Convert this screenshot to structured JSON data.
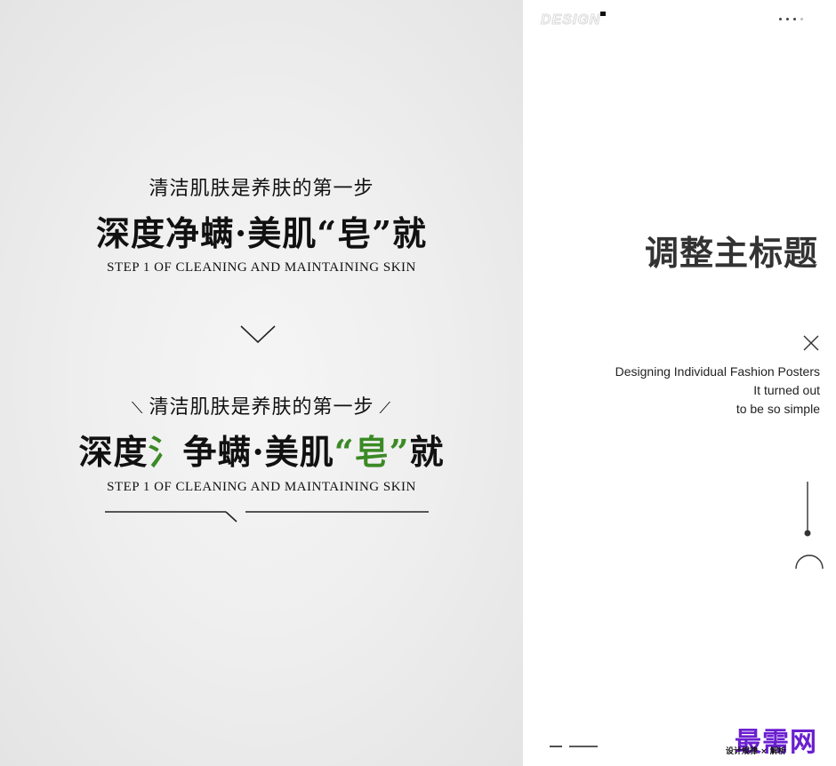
{
  "poster": {
    "block1": {
      "subtitle": "清洁肌肤是养肤的第一步",
      "title": "深度净螨·美肌“皂”就",
      "caption": "STEP 1 OF CLEANING AND MAINTAINING SKIN"
    },
    "block2": {
      "subtitle": "清洁肌肤是养肤的第一步",
      "title_parts": [
        "深度",
        "氵",
        "争螨·美肌",
        "“皂”",
        "就"
      ],
      "caption": "STEP 1 OF CLEANING AND MAINTAINING SKIN"
    },
    "accent_color": "#3b8a25"
  },
  "right": {
    "brand": "DESIGN",
    "main_title": "调整主标题",
    "description": [
      "Designing Individual Fashion Posters",
      "It turned out",
      "to be so simple"
    ],
    "footer_text": "设计规律 × 解析",
    "watermark": "最需网",
    "watermark_color": "#6a1fd0"
  }
}
